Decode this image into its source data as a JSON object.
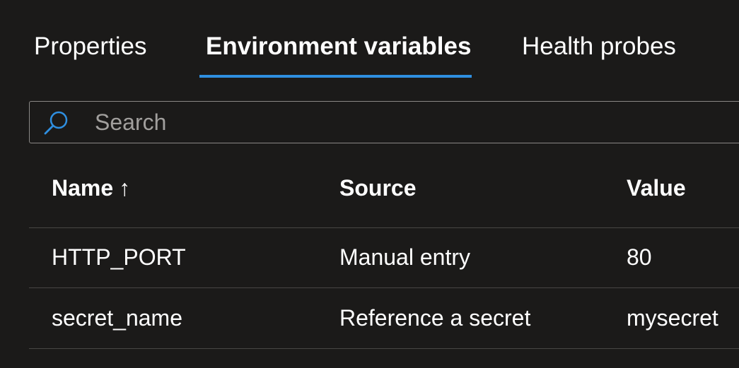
{
  "tabs": [
    {
      "label": "Properties"
    },
    {
      "label": "Environment variables",
      "selected": true
    },
    {
      "label": "Health probes"
    }
  ],
  "search": {
    "placeholder": "Search",
    "value": ""
  },
  "table": {
    "columns": [
      {
        "label": "Name",
        "sort_indicator": "↑"
      },
      {
        "label": "Source"
      },
      {
        "label": "Value"
      }
    ],
    "rows": [
      {
        "name": "HTTP_PORT",
        "source": "Manual entry",
        "value": "80"
      },
      {
        "name": "secret_name",
        "source": "Reference a secret",
        "value": "mysecret"
      }
    ]
  },
  "colors": {
    "background": "#1b1a19",
    "accent": "#2f8fe0",
    "divider": "#484644"
  }
}
